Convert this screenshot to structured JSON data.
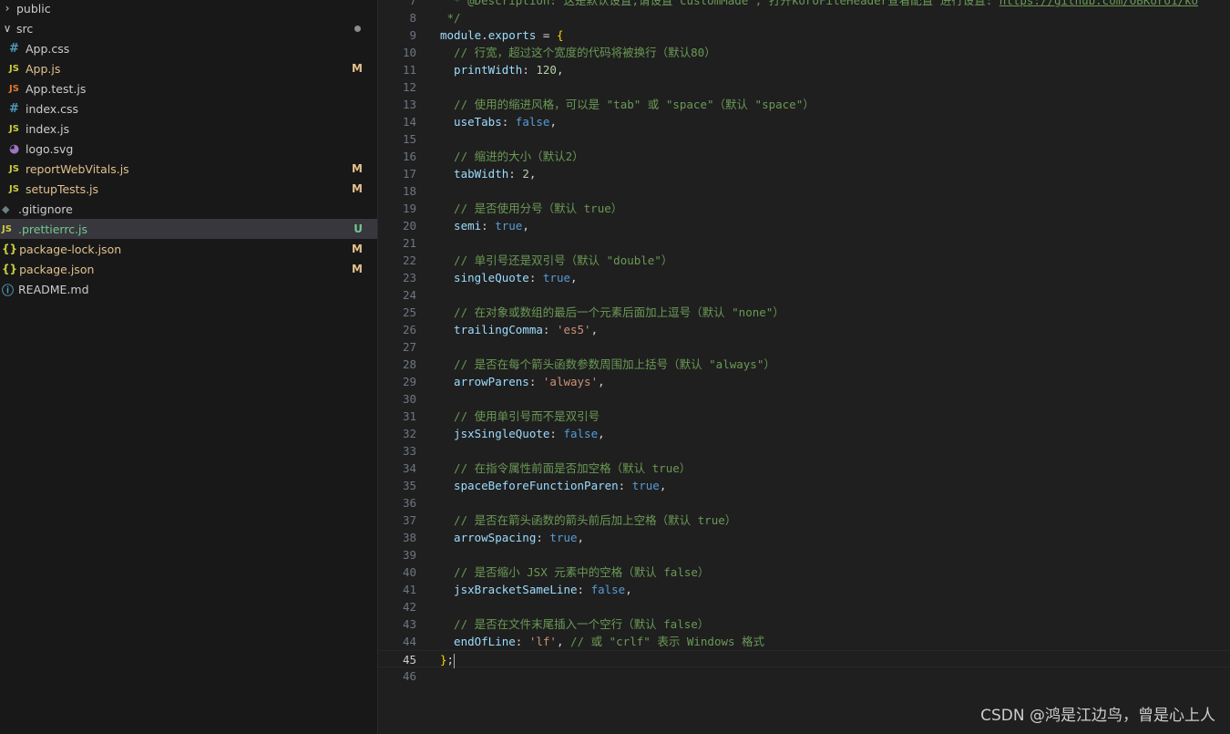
{
  "explorer": {
    "items": [
      {
        "kind": "folder",
        "expanded": false,
        "name": "public",
        "badge": "",
        "status": ""
      },
      {
        "kind": "folder",
        "expanded": true,
        "name": "src",
        "badge": "dot",
        "status": ""
      },
      {
        "kind": "file",
        "icon": "#",
        "iconColor": "#519aba",
        "name": "App.css",
        "badge": "",
        "status": ""
      },
      {
        "kind": "file",
        "icon": "JS",
        "iconColor": "#cbcb41",
        "name": "App.js",
        "badge": "M",
        "status": "mod"
      },
      {
        "kind": "file",
        "icon": "JS",
        "iconColor": "#e37933",
        "name": "App.test.js",
        "badge": "",
        "status": ""
      },
      {
        "kind": "file",
        "icon": "#",
        "iconColor": "#519aba",
        "name": "index.css",
        "badge": "",
        "status": ""
      },
      {
        "kind": "file",
        "icon": "JS",
        "iconColor": "#cbcb41",
        "name": "index.js",
        "badge": "",
        "status": ""
      },
      {
        "kind": "file",
        "icon": "svg",
        "iconColor": "#a074c4",
        "name": "logo.svg",
        "badge": "",
        "status": ""
      },
      {
        "kind": "file",
        "icon": "JS",
        "iconColor": "#cbcb41",
        "name": "reportWebVitals.js",
        "badge": "M",
        "status": "mod"
      },
      {
        "kind": "file",
        "icon": "JS",
        "iconColor": "#cbcb41",
        "name": "setupTests.js",
        "badge": "M",
        "status": "mod"
      },
      {
        "kind": "root",
        "icon": "git",
        "iconColor": "#6d8086",
        "name": ".gitignore",
        "badge": "",
        "status": ""
      },
      {
        "kind": "root",
        "icon": "JS",
        "iconColor": "#cbcb41",
        "name": ".prettierrc.js",
        "badge": "U",
        "status": "untracked",
        "selected": true
      },
      {
        "kind": "root",
        "icon": "{}",
        "iconColor": "#cbcb41",
        "name": "package-lock.json",
        "badge": "M",
        "status": "mod"
      },
      {
        "kind": "root",
        "icon": "{}",
        "iconColor": "#cbcb41",
        "name": "package.json",
        "badge": "M",
        "status": "mod"
      },
      {
        "kind": "root",
        "icon": "i",
        "iconColor": "#519aba",
        "name": "README.md",
        "badge": "",
        "status": ""
      }
    ]
  },
  "editor": {
    "first_line_number": 7,
    "active_line": 45,
    "lines": [
      [
        [
          "comment",
          "  * @Description: 这是默认设置,请设置 customMade , 打开koroFileHeader查看配置 进行设置: "
        ],
        [
          "link",
          "https://github.com/OBKoro1/ko"
        ]
      ],
      [
        [
          "comment",
          " */"
        ]
      ],
      [
        [
          "prop",
          "module"
        ],
        [
          "punct",
          "."
        ],
        [
          "prop",
          "exports"
        ],
        [
          "punct",
          " = "
        ],
        [
          "brace",
          "{"
        ]
      ],
      [
        [
          "comment",
          "  // 行宽，超过这个宽度的代码将被换行（默认80）"
        ]
      ],
      [
        [
          "prop",
          "  printWidth"
        ],
        [
          "punct",
          ": "
        ],
        [
          "num",
          "120"
        ],
        [
          "punct",
          ","
        ]
      ],
      [],
      [
        [
          "comment",
          "  // 使用的缩进风格，可以是 \"tab\" 或 \"space\"（默认 \"space\"）"
        ]
      ],
      [
        [
          "prop",
          "  useTabs"
        ],
        [
          "punct",
          ": "
        ],
        [
          "bool",
          "false"
        ],
        [
          "punct",
          ","
        ]
      ],
      [],
      [
        [
          "comment",
          "  // 缩进的大小（默认2）"
        ]
      ],
      [
        [
          "prop",
          "  tabWidth"
        ],
        [
          "punct",
          ": "
        ],
        [
          "num",
          "2"
        ],
        [
          "punct",
          ","
        ]
      ],
      [],
      [
        [
          "comment",
          "  // 是否使用分号（默认 true）"
        ]
      ],
      [
        [
          "prop",
          "  semi"
        ],
        [
          "punct",
          ": "
        ],
        [
          "bool",
          "true"
        ],
        [
          "punct",
          ","
        ]
      ],
      [],
      [
        [
          "comment",
          "  // 单引号还是双引号（默认 \"double\"）"
        ]
      ],
      [
        [
          "prop",
          "  singleQuote"
        ],
        [
          "punct",
          ": "
        ],
        [
          "bool",
          "true"
        ],
        [
          "punct",
          ","
        ]
      ],
      [],
      [
        [
          "comment",
          "  // 在对象或数组的最后一个元素后面加上逗号（默认 \"none\"）"
        ]
      ],
      [
        [
          "prop",
          "  trailingComma"
        ],
        [
          "punct",
          ": "
        ],
        [
          "str",
          "'es5'"
        ],
        [
          "punct",
          ","
        ]
      ],
      [],
      [
        [
          "comment",
          "  // 是否在每个箭头函数参数周围加上括号（默认 \"always\"）"
        ]
      ],
      [
        [
          "prop",
          "  arrowParens"
        ],
        [
          "punct",
          ": "
        ],
        [
          "str",
          "'always'"
        ],
        [
          "punct",
          ","
        ]
      ],
      [],
      [
        [
          "comment",
          "  // 使用单引号而不是双引号"
        ]
      ],
      [
        [
          "prop",
          "  jsxSingleQuote"
        ],
        [
          "punct",
          ": "
        ],
        [
          "bool",
          "false"
        ],
        [
          "punct",
          ","
        ]
      ],
      [],
      [
        [
          "comment",
          "  // 在指令属性前面是否加空格（默认 true）"
        ]
      ],
      [
        [
          "prop",
          "  spaceBeforeFunctionParen"
        ],
        [
          "punct",
          ": "
        ],
        [
          "bool",
          "true"
        ],
        [
          "punct",
          ","
        ]
      ],
      [],
      [
        [
          "comment",
          "  // 是否在箭头函数的箭头前后加上空格（默认 true）"
        ]
      ],
      [
        [
          "prop",
          "  arrowSpacing"
        ],
        [
          "punct",
          ": "
        ],
        [
          "bool",
          "true"
        ],
        [
          "punct",
          ","
        ]
      ],
      [],
      [
        [
          "comment",
          "  // 是否缩小 JSX 元素中的空格（默认 false）"
        ]
      ],
      [
        [
          "prop",
          "  jsxBracketSameLine"
        ],
        [
          "punct",
          ": "
        ],
        [
          "bool",
          "false"
        ],
        [
          "punct",
          ","
        ]
      ],
      [],
      [
        [
          "comment",
          "  // 是否在文件末尾插入一个空行（默认 false）"
        ]
      ],
      [
        [
          "prop",
          "  endOfLine"
        ],
        [
          "punct",
          ": "
        ],
        [
          "str",
          "'lf'"
        ],
        [
          "punct",
          ", "
        ],
        [
          "comment",
          "// 或 \"crlf\" 表示 Windows 格式"
        ]
      ],
      [
        [
          "brace",
          "}"
        ],
        [
          "punct",
          ";"
        ],
        [
          "cursor",
          ""
        ]
      ],
      []
    ]
  },
  "watermark": "CSDN @鸿是江边鸟，曾是心上人"
}
